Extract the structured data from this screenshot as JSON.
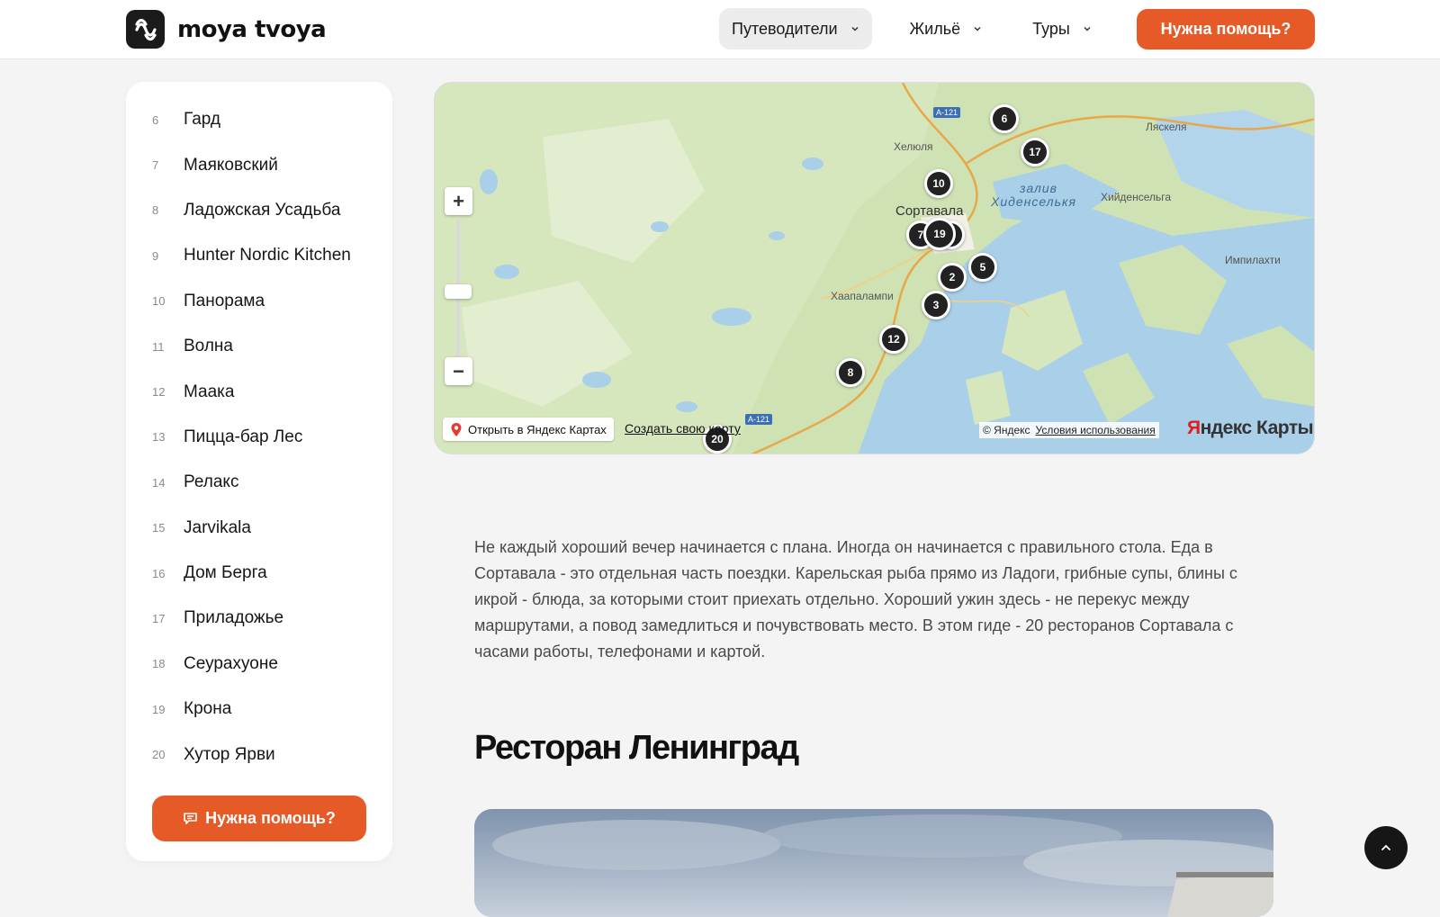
{
  "header": {
    "brand": "moya tvoya",
    "nav": [
      {
        "label": "Путеводители"
      },
      {
        "label": "Жильё"
      },
      {
        "label": "Туры"
      }
    ],
    "help_label": "Нужна помощь?"
  },
  "sidebar": {
    "items": [
      {
        "num": "6",
        "label": "Гард"
      },
      {
        "num": "7",
        "label": "Маяковский"
      },
      {
        "num": "8",
        "label": "Ладожская Усадьба"
      },
      {
        "num": "9",
        "label": "Hunter Nordic Kitchen"
      },
      {
        "num": "10",
        "label": "Панорама"
      },
      {
        "num": "11",
        "label": "Волна"
      },
      {
        "num": "12",
        "label": "Маака"
      },
      {
        "num": "13",
        "label": "Пицца-бар Лес"
      },
      {
        "num": "14",
        "label": "Релакс"
      },
      {
        "num": "15",
        "label": "Jarvikala"
      },
      {
        "num": "16",
        "label": "Дом Берга"
      },
      {
        "num": "17",
        "label": "Приладожье"
      },
      {
        "num": "18",
        "label": "Сеурахуоне"
      },
      {
        "num": "19",
        "label": "Крона"
      },
      {
        "num": "20",
        "label": "Хутор Ярви"
      }
    ],
    "help_label": "Нужна помощь?"
  },
  "map": {
    "places": {
      "sortavala": "Сортавала",
      "helyulya": "Хелюля",
      "haapalampi": "Хаапалампи",
      "lahdenpohja": "Ляскеля",
      "hiidenselga": "Хийденсельга",
      "impilahti": "Импилахти",
      "bay_line1": "залив",
      "bay_line2": "Хиденселькя"
    },
    "road": "A-121",
    "markers": [
      "6",
      "17",
      "10",
      "7",
      "19",
      "5",
      "2",
      "3",
      "12",
      "8",
      "20"
    ],
    "open_in_maps": "Открыть в Яндекс Картах",
    "create_map": "Создать свою карту",
    "copyright": "© Яндекс",
    "terms": "Условия использования",
    "logo_y": "Я",
    "logo_rest": "ндекс Карты"
  },
  "article": {
    "intro": "Не каждый хороший вечер начинается с плана. Иногда он начинается с правильного стола. Еда в Сортавала - это отдельная часть поездки. Карельская рыба прямо из Ладоги, грибные супы, блины с икрой - блюда, за которыми стоит приехать отдельно. Хороший ужин здесь - не перекус между маршрутами, а повод замедлиться и почувствовать место. В этом гиде - 20 ресторанов Сортавала с часами работы, телефонами и картой.",
    "heading": "Ресторан Ленинград"
  },
  "colors": {
    "accent": "#e65a28",
    "water": "#a9cfe9",
    "land": "#e6ecd8",
    "forest": "#c9e0b0",
    "marker": "#222222"
  }
}
